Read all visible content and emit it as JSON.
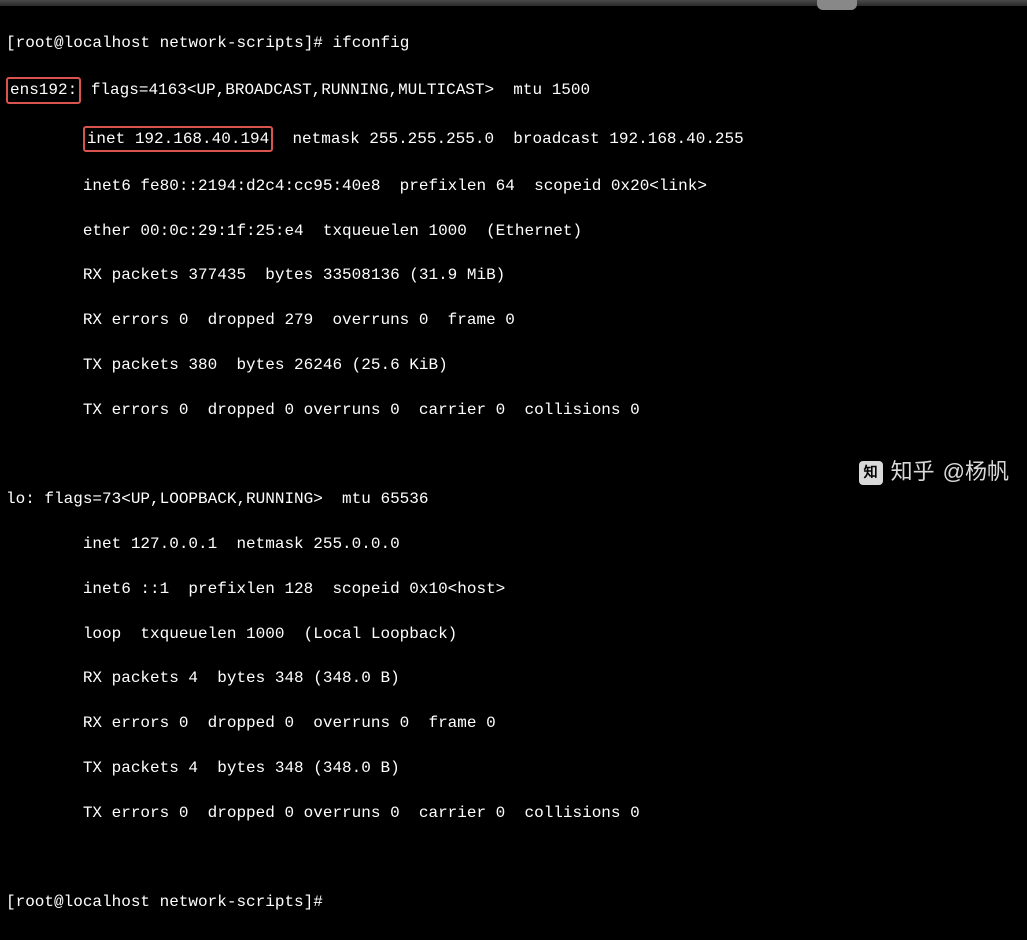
{
  "prompt1": {
    "user": "root",
    "host": "localhost",
    "cwd": "network-scripts",
    "command": "ifconfig"
  },
  "iface1": {
    "name": "ens192:",
    "flags": "flags=4163<UP,BROADCAST,RUNNING,MULTICAST>  mtu 1500",
    "inet": "inet 192.168.40.194",
    "inet_rest": "  netmask 255.255.255.0  broadcast 192.168.40.255",
    "inet6": "inet6 fe80::2194:d2c4:cc95:40e8  prefixlen 64  scopeid 0x20<link>",
    "ether": "ether 00:0c:29:1f:25:e4  txqueuelen 1000  (Ethernet)",
    "rxp": "RX packets 377435  bytes 33508136 (31.9 MiB)",
    "rxe": "RX errors 0  dropped 279  overruns 0  frame 0",
    "txp": "TX packets 380  bytes 26246 (25.6 KiB)",
    "txe": "TX errors 0  dropped 0 overruns 0  carrier 0  collisions 0"
  },
  "iface2": {
    "header": "lo: flags=73<UP,LOOPBACK,RUNNING>  mtu 65536",
    "inet": "inet 127.0.0.1  netmask 255.0.0.0",
    "inet6": "inet6 ::1  prefixlen 128  scopeid 0x10<host>",
    "loop": "loop  txqueuelen 1000  (Local Loopback)",
    "rxp": "RX packets 4  bytes 348 (348.0 B)",
    "rxe": "RX errors 0  dropped 0  overruns 0  frame 0",
    "txp": "TX packets 4  bytes 348 (348.0 B)",
    "txe": "TX errors 0  dropped 0 overruns 0  carrier 0  collisions 0"
  },
  "prompt2": {
    "text": "[root@localhost network-scripts]# "
  },
  "watermark": {
    "brand": "知乎",
    "author": "@杨帆",
    "icon": "知"
  },
  "indent": "        "
}
